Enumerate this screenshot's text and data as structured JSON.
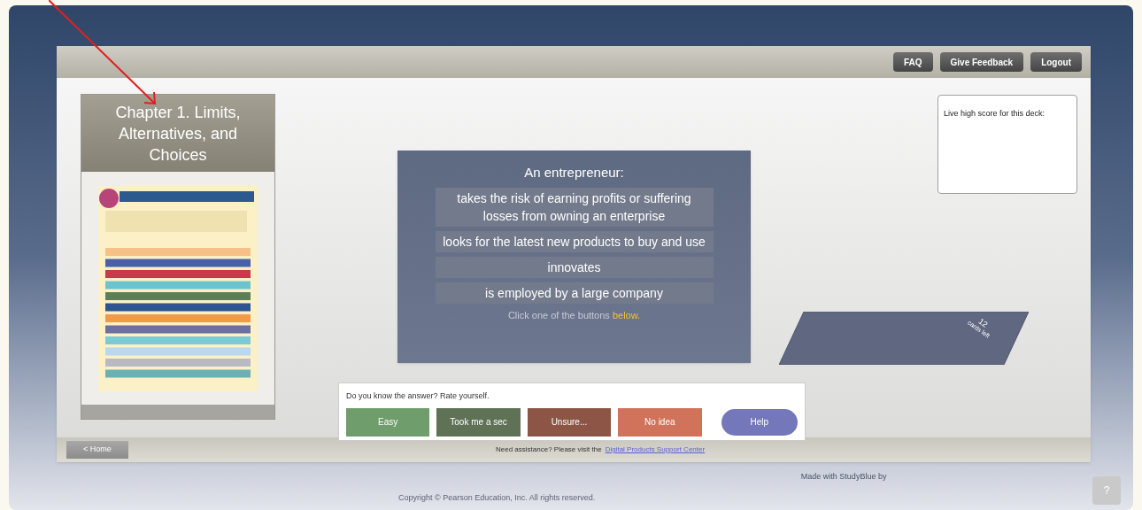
{
  "top_bar": {
    "buttons": [
      "FAQ",
      "Give Feedback",
      "Logout"
    ]
  },
  "deck": {
    "title": "Chapter 1. Limits, Alternatives, and Choices"
  },
  "question": {
    "prompt": "An entrepreneur:",
    "options": [
      {
        "text": "takes the risk of earning profits or suffering losses from owning an enterprise"
      },
      {
        "text": "looks for the latest new products to buy and use"
      },
      {
        "text": "innovates"
      },
      {
        "text": "is employed by a large company"
      }
    ],
    "hint": "Click one of the buttons **below.**"
  },
  "high_score": {
    "label": "Live high score for this deck:"
  },
  "card_stack": {
    "count": "12",
    "label": "cards left"
  },
  "rating": {
    "prompt": "Do you know the answer? Rate yourself.",
    "buttons": [
      {
        "label": "Easy",
        "color": "#6f9e6c"
      },
      {
        "label": "Took me a sec",
        "color": "#5f7256"
      },
      {
        "label": "Unsure...",
        "color": "#8c5546"
      },
      {
        "label": "No idea",
        "color": "#d0735a"
      }
    ],
    "help": "Help"
  },
  "bottom_bar": {
    "home": "< Home",
    "support_text": "Need assistance? Please visit the",
    "support_link": "Digital Products Support Center"
  },
  "footer": {
    "copyright": "Copyright © Pearson Education, Inc. All rights reserved.",
    "credit": "Made with StudyBlue by",
    "help_button": "?"
  }
}
